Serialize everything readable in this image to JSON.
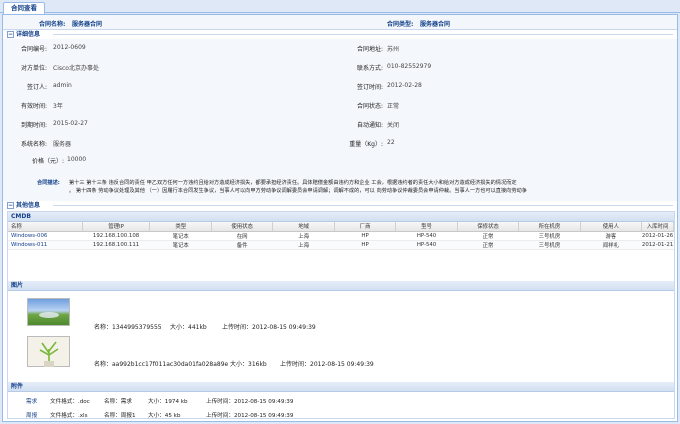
{
  "tab": {
    "label": "合同查看"
  },
  "top": {
    "name_label": "合同名称:",
    "name_value": "服务器合同",
    "type_label": "合同类型:",
    "type_value": "服务器合同"
  },
  "detail": {
    "title": "详细信息",
    "left": [
      {
        "label": "合同编号:",
        "value": "2012-0609"
      },
      {
        "label": "对方单位:",
        "value": "Cisco北京办事处"
      },
      {
        "label": "签订人:",
        "value": "admin"
      },
      {
        "label": "有效时间:",
        "value": "3年"
      },
      {
        "label": "到期时间:",
        "value": "2015-02-27"
      },
      {
        "label": "系统名称:",
        "value": "服务器"
      },
      {
        "label": "价格（元）:",
        "value": "10000"
      }
    ],
    "right": [
      {
        "label": "合同地址:",
        "value": "苏州"
      },
      {
        "label": "联系方式:",
        "value": "010-82552979"
      },
      {
        "label": "签订时间:",
        "value": "2012-02-28"
      },
      {
        "label": "合同状态:",
        "value": "正常"
      },
      {
        "label": "自动通知:",
        "value": "关闭"
      },
      {
        "label": "重量（Kg）:",
        "value": "22"
      }
    ]
  },
  "description": {
    "label": "合同描述:",
    "line1": "第十三 第十三条 违反合同的责任 甲乙双方任何一方违约且给对方造成经济损失，都要承担经济责任。具体赔偿金额由违约方和企业 工会，根据违约者的责任大小和给对方造成经济损失的情况而定",
    "line2": "。 第十四条 劳动争议处理及其他 （一）因履行本合同发生争议，当事人可以向甲方劳动争议调解委员会申请调解；调解不成的，可以 向劳动争议仲裁委员会申请仲裁。当事人一方也可以直接向劳动争"
  },
  "other": {
    "title": "其他信息",
    "cmdb_title": "CMDB",
    "columns": [
      "名称",
      "管理IP",
      "类型",
      "使用状态",
      "地域",
      "厂商",
      "型号",
      "保修状态",
      "所在机房",
      "使用人",
      "入库时间"
    ],
    "rows": [
      [
        "Windows-006",
        "192.168.100.108",
        "笔记本",
        "在网",
        "上海",
        "HP",
        "HP-540",
        "正常",
        "三号机房",
        "游客",
        "2012-01-26"
      ],
      [
        "Windows-011",
        "192.168.100.111",
        "笔记本",
        "备件",
        "上海",
        "HP",
        "HP-540",
        "正常",
        "三号机房",
        "闻祥礼",
        "2012-01-21"
      ]
    ],
    "pictures_title": "图片",
    "pictures": [
      {
        "name": "名称：1344995379555",
        "size": "大小：441kb",
        "time": "上传时间：2012-08-15 09:49:39"
      },
      {
        "name": "名称：aa992b1cc17f011ac30da01fa028a89e",
        "size": "大小：316kb",
        "time": "上传时间：2012-08-15 09:49:39"
      }
    ],
    "attachments_title": "附件",
    "attachments": [
      {
        "link": "需求",
        "format": "文件格式：.doc",
        "name": "名称：需求",
        "size": "大小：1974 kb",
        "time": "上传时间：2012-08-15 09:49:39"
      },
      {
        "link": "周报",
        "format": "文件格式：.xls",
        "name": "名称：周报1",
        "size": "大小：45 kb",
        "time": "上传时间：2012-08-15 09:49:39"
      }
    ]
  },
  "colors": {
    "accent": "#15428b",
    "border": "#99bbe8",
    "bg": "#dfe8f6"
  }
}
